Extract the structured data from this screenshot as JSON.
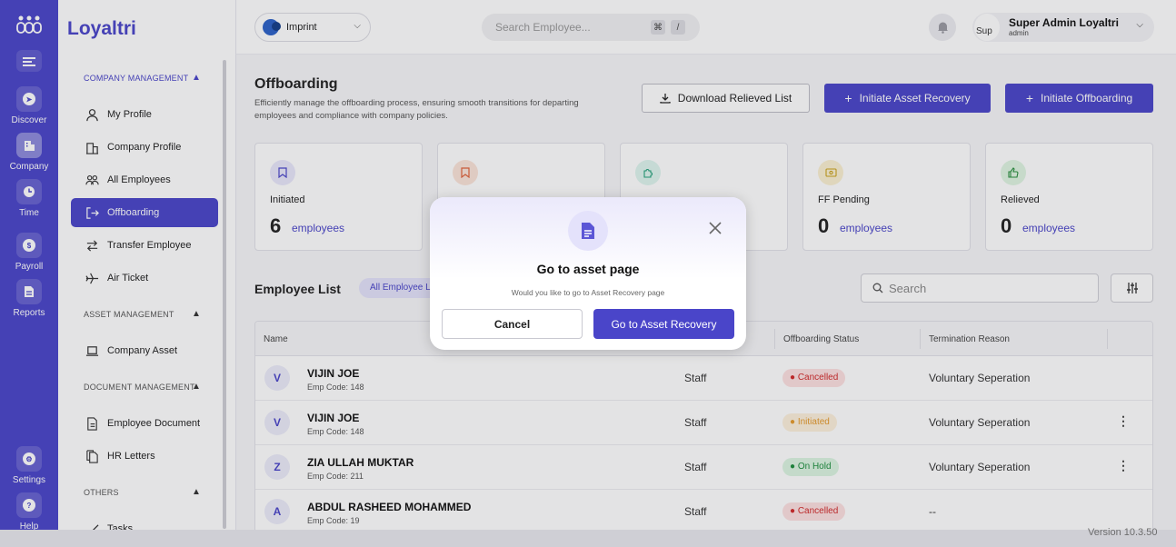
{
  "app": {
    "brand": "Loyaltri",
    "version": "Version 10.3.50"
  },
  "rail": {
    "items": [
      {
        "label": "Discover",
        "icon": "compass-icon"
      },
      {
        "label": "Company",
        "icon": "building-icon"
      },
      {
        "label": "Time",
        "icon": "clock-icon"
      },
      {
        "label": "Payroll",
        "icon": "dollar-icon"
      },
      {
        "label": "Reports",
        "icon": "document-icon"
      },
      {
        "label": "Settings",
        "icon": "gear-icon"
      },
      {
        "label": "Help",
        "icon": "question-icon"
      }
    ]
  },
  "sidebar": {
    "sections": [
      {
        "title": "COMPANY MANAGEMENT"
      },
      {
        "title": "ASSET MANAGEMENT"
      },
      {
        "title": "DOCUMENT MANAGEMENT"
      },
      {
        "title": "OTHERS"
      }
    ],
    "items": [
      {
        "label": "My Profile"
      },
      {
        "label": "Company Profile"
      },
      {
        "label": "All Employees"
      },
      {
        "label": "Offboarding"
      },
      {
        "label": "Transfer Employee"
      },
      {
        "label": "Air Ticket"
      },
      {
        "label": "Company Asset"
      },
      {
        "label": "Employee Document"
      },
      {
        "label": "HR Letters"
      },
      {
        "label": "Tasks"
      }
    ]
  },
  "header": {
    "org_name": "Imprint",
    "search_placeholder": "Search Employee...",
    "shortcut_cmd": "⌘",
    "shortcut_key": "/",
    "user_name": "Super Admin Loyaltri",
    "user_role": "admin",
    "avatar_text": "Sup"
  },
  "page": {
    "title": "Offboarding",
    "subtitle": "Efficiently manage the offboarding process, ensuring smooth transitions for departing employees and compliance with company policies.",
    "download_label": "Download Relieved List",
    "asset_recovery_label": "Initiate Asset Recovery",
    "offboarding_label": "Initiate Offboarding"
  },
  "stats": [
    {
      "label": "Initiated",
      "count": "6",
      "unit": "employees",
      "color": "#e8e7fb"
    },
    {
      "label": "",
      "count": "",
      "unit": "",
      "color": "#fbe4d8"
    },
    {
      "label": "",
      "count": "",
      "unit": "",
      "color": "#def5ee"
    },
    {
      "label": "FF Pending",
      "count": "0",
      "unit": "employees",
      "color": "#fbf1d2"
    },
    {
      "label": "Relieved",
      "count": "0",
      "unit": "employees",
      "color": "#dff5e2"
    }
  ],
  "employee_list": {
    "title": "Employee List",
    "filter_chip": "All Employee List",
    "search_placeholder": "Search",
    "columns": [
      "Name",
      "Offboarding Status",
      "Termination Reason"
    ],
    "rows": [
      {
        "initial": "V",
        "name": "VIJIN JOE",
        "code": "Emp Code: 148",
        "designation": "Staff",
        "status": "Cancelled",
        "status_color": "red",
        "reason": "Voluntary Seperation",
        "has_menu": false
      },
      {
        "initial": "V",
        "name": "VIJIN JOE",
        "code": "Emp Code: 148",
        "designation": "Staff",
        "status": "Initiated",
        "status_color": "orange",
        "reason": "Voluntary Seperation",
        "has_menu": true
      },
      {
        "initial": "Z",
        "name": "ZIA ULLAH MUKTAR",
        "code": "Emp Code: 211",
        "designation": "Staff",
        "status": "On Hold",
        "status_color": "green",
        "reason": "Voluntary Seperation",
        "has_menu": true
      },
      {
        "initial": "A",
        "name": "ABDUL RASHEED MOHAMMED",
        "code": "Emp Code: 19",
        "designation": "Staff",
        "status": "Cancelled",
        "status_color": "red",
        "reason": "--",
        "has_menu": false
      }
    ]
  },
  "modal": {
    "title": "Go to asset page",
    "message": "Would you like to go to Asset Recovery page",
    "cancel_label": "Cancel",
    "confirm_label": "Go to Asset Recovery",
    "icon": "document-icon",
    "close_icon": "close-icon"
  }
}
